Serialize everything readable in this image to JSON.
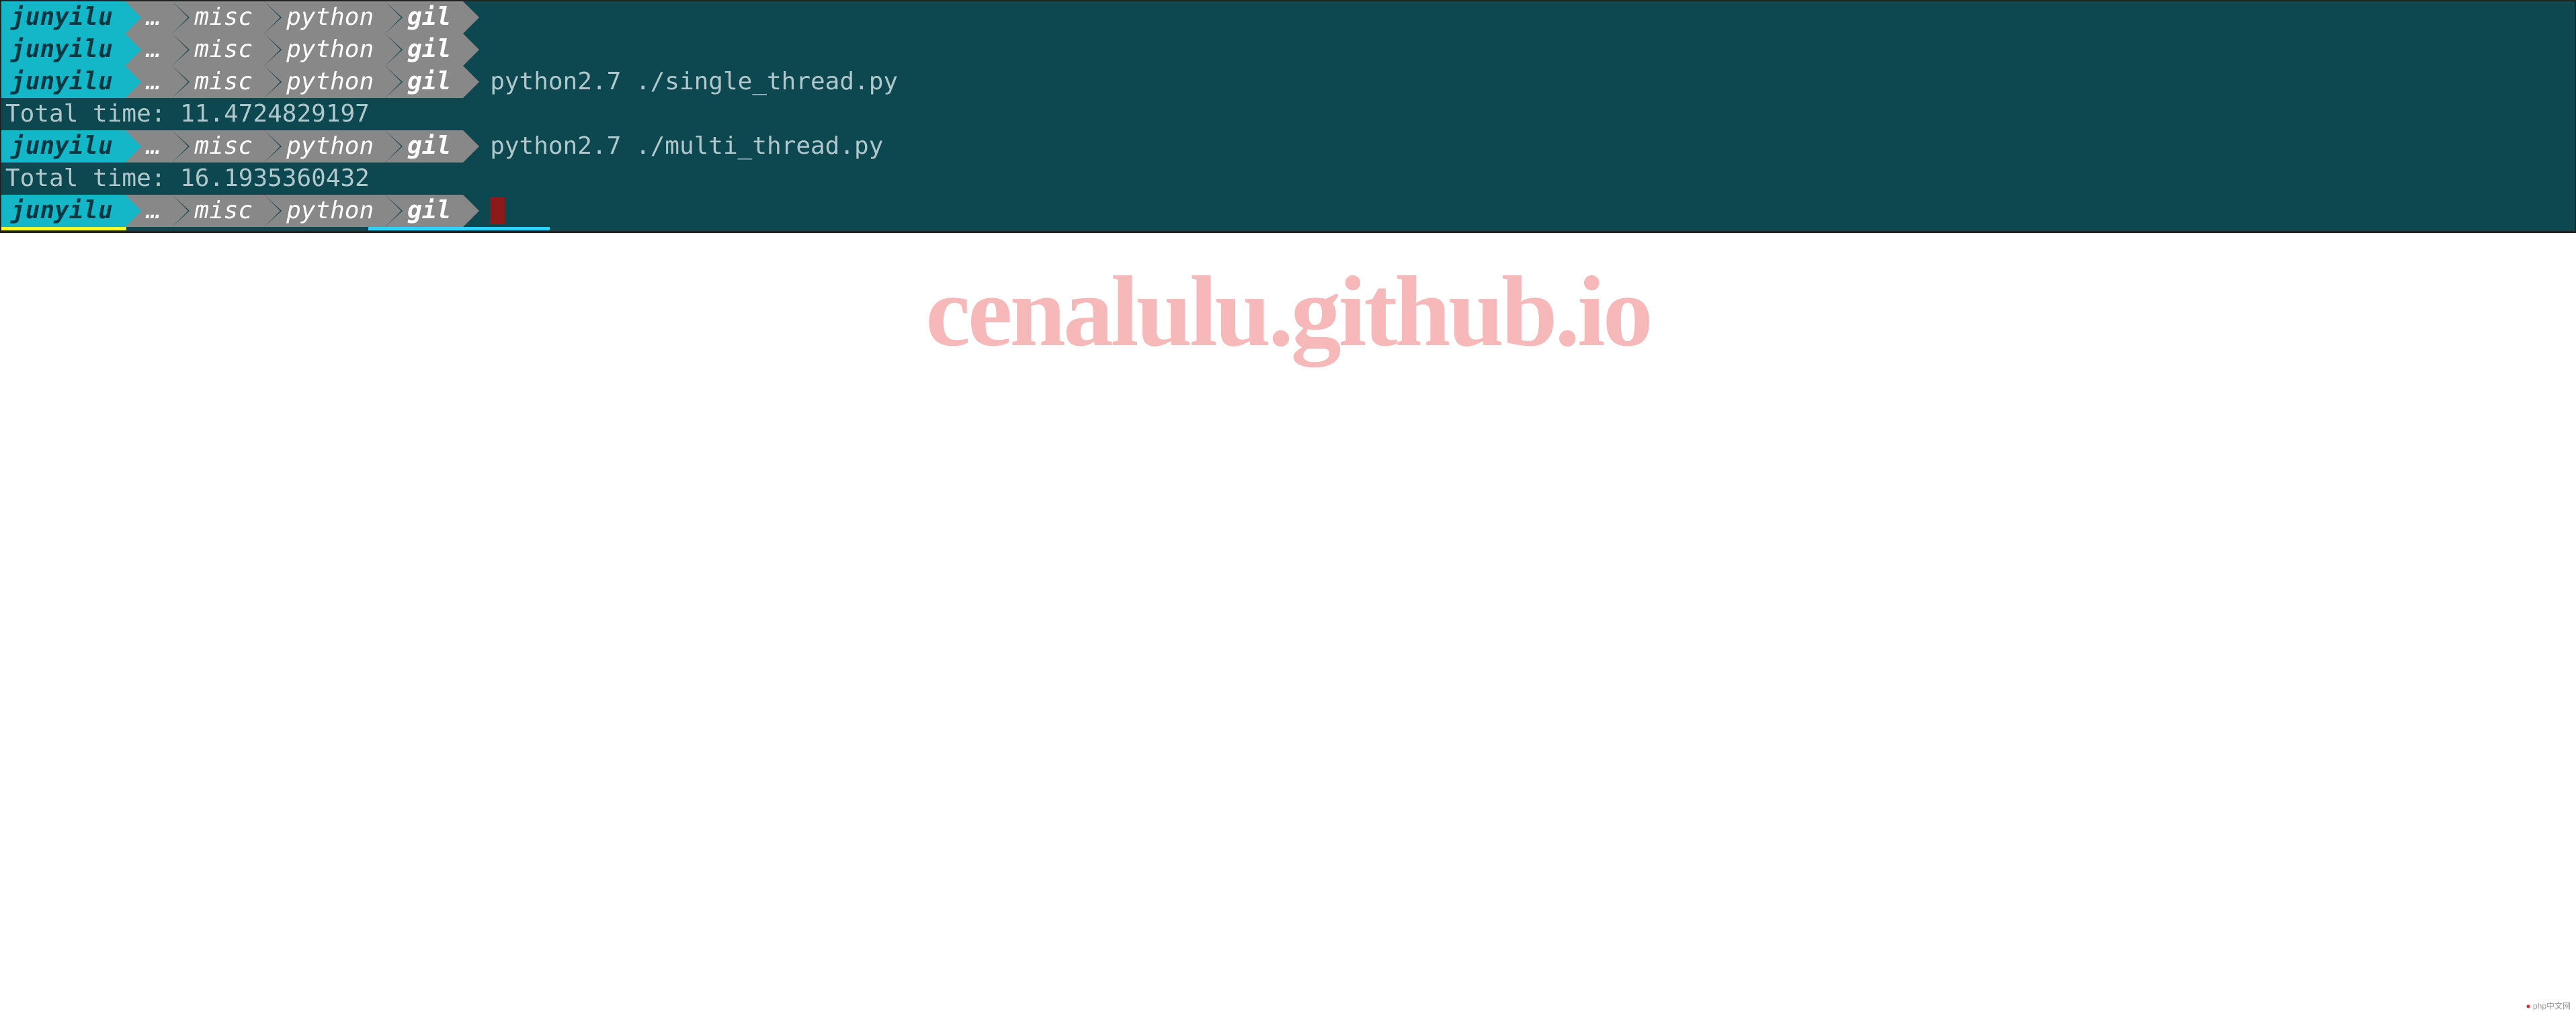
{
  "prompt": {
    "user": "junyilu",
    "ellipsis": "…",
    "path": [
      "misc",
      "python",
      "gil"
    ]
  },
  "lines": [
    {
      "type": "prompt",
      "command": ""
    },
    {
      "type": "prompt",
      "command": ""
    },
    {
      "type": "prompt",
      "command": "python2.7 ./single_thread.py"
    },
    {
      "type": "output",
      "text": "Total time: 11.4724829197"
    },
    {
      "type": "prompt",
      "command": "python2.7 ./multi_thread.py"
    },
    {
      "type": "output",
      "text": "Total time: 16.1935360432"
    },
    {
      "type": "prompt",
      "command": "",
      "cursor": true
    }
  ],
  "watermark": "cenalulu.github.io",
  "corner_badge": "php中文网"
}
